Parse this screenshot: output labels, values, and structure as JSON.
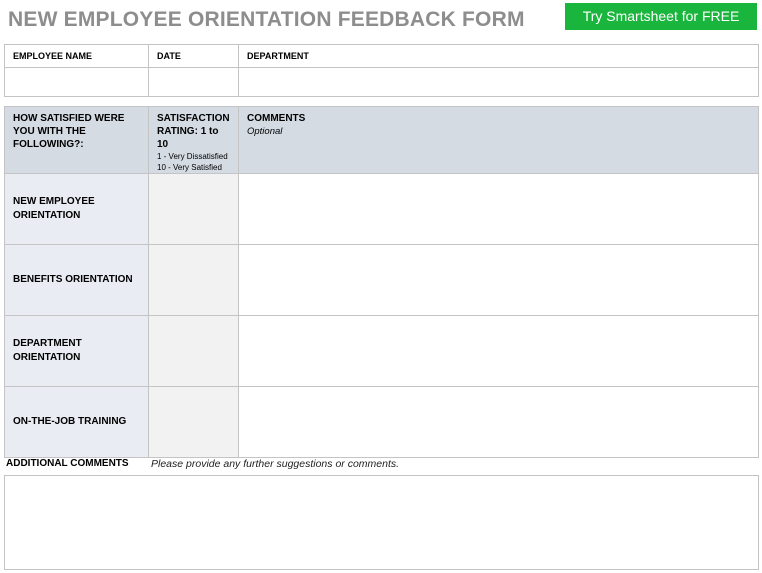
{
  "header": {
    "title": "NEW EMPLOYEE ORIENTATION FEEDBACK FORM",
    "cta_label": "Try Smartsheet for FREE",
    "cta_color": "#1ab53c",
    "title_color": "#8d8d8d"
  },
  "info_table": {
    "columns": [
      "EMPLOYEE NAME",
      "DATE",
      "DEPARTMENT"
    ],
    "values": [
      "",
      "",
      ""
    ]
  },
  "feedback_table": {
    "header": {
      "question": "HOW SATISFIED WERE YOU WITH THE FOLLOWING?:",
      "rating_title": "SATISFACTION RATING: 1 to 10",
      "rating_scale_low": "1 - Very Dissatisfied",
      "rating_scale_high": "10 - Very Satisfied",
      "comments_title": "COMMENTS",
      "comments_note": "Optional"
    },
    "rows": [
      {
        "label": "NEW EMPLOYEE ORIENTATION",
        "rating": "",
        "comments": ""
      },
      {
        "label": "BENEFITS ORIENTATION",
        "rating": "",
        "comments": ""
      },
      {
        "label": "DEPARTMENT ORIENTATION",
        "rating": "",
        "comments": ""
      },
      {
        "label": "ON-THE-JOB TRAINING",
        "rating": "",
        "comments": ""
      }
    ],
    "header_bg": "#d5dbe3",
    "label_bg": "#e9ecf3",
    "rating_bg": "#f2f2f2"
  },
  "additional": {
    "label": "ADDITIONAL COMMENTS",
    "hint": "Please provide any further suggestions or comments.",
    "value": ""
  }
}
